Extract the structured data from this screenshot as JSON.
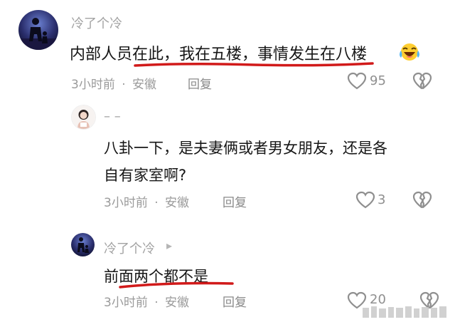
{
  "comments": [
    {
      "username": "冷了个冷",
      "text": "内部人员在此，我在五楼，事情发生在八楼",
      "time": "3小时前",
      "separator": "·",
      "location": "安徽",
      "reply_label": "回复",
      "likes": "95"
    },
    {
      "username": "–    –",
      "text_line1": "八卦一下，是夫妻俩或者男女朋友，还是各",
      "text_line2": "自有家室啊?",
      "time": "3小时前",
      "separator": "·",
      "location": "安徽",
      "reply_label": "回复",
      "likes": "3"
    },
    {
      "username": "冷了个冷",
      "author_mark": "▸",
      "text": "前面两个都不是",
      "time": "3小时前",
      "separator": "·",
      "location": "安徽",
      "reply_label": "回复",
      "likes": "20"
    }
  ],
  "icons": {
    "emoji": "laughing-crying-emoji",
    "like": "heart-icon",
    "dislike": "broken-heart-icon",
    "author": "play-icon"
  },
  "colors": {
    "underline": "#d11a1a",
    "username": "#a3a3a3",
    "text": "#161616",
    "meta": "#9a9a9a"
  }
}
